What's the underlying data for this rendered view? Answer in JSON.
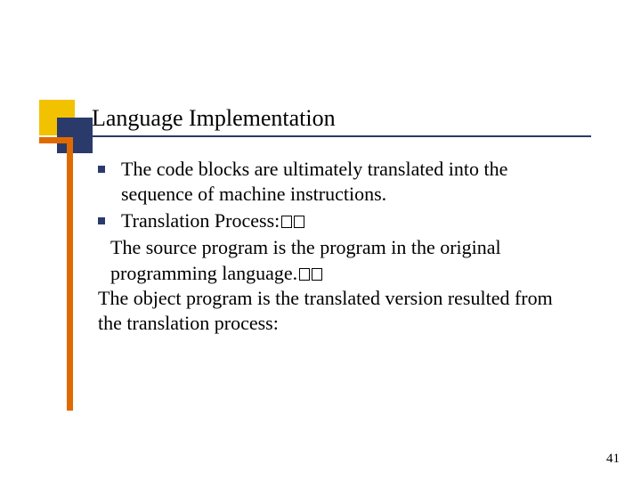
{
  "slide": {
    "title": "Language Implementation",
    "bullets": [
      "The code blocks are ultimately translated into the sequence of machine instructions.",
      "Translation Process:"
    ],
    "para1": "The source program is the program in the original programming language.",
    "para2": "The object program is the translated version resulted from the translation process:",
    "page_number": "41"
  }
}
